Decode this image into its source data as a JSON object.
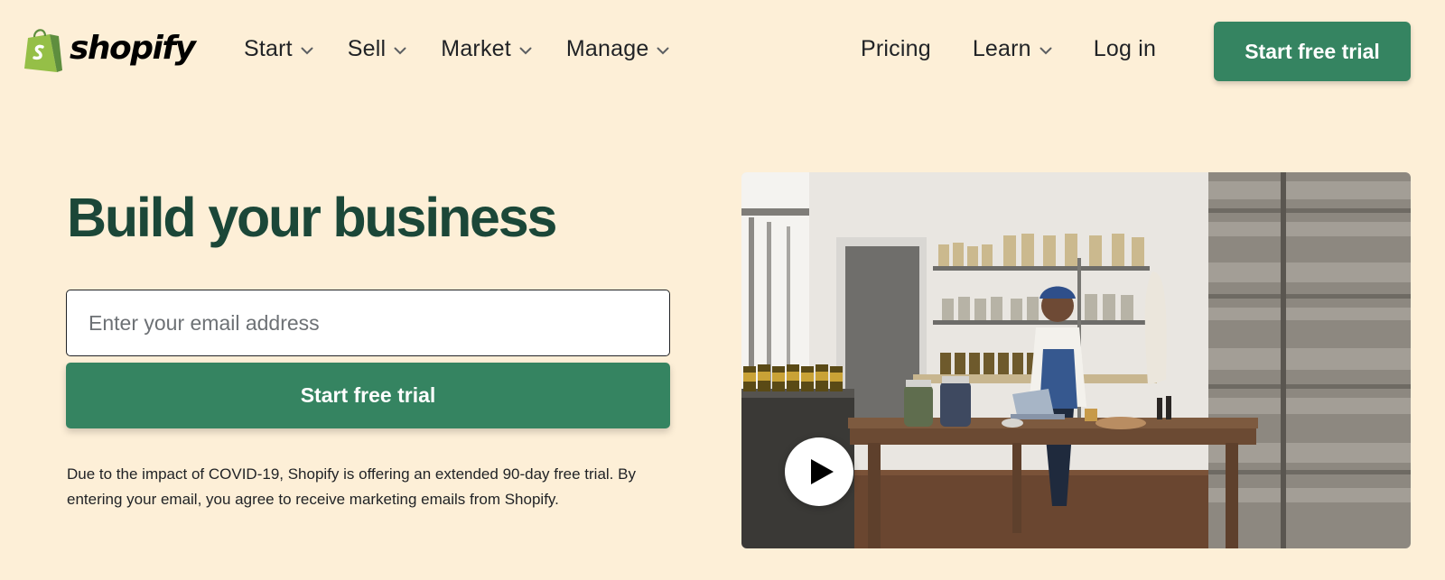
{
  "brand": {
    "logo_icon": "shopping-bag-logo",
    "wordmark": "shopify",
    "logo_green": "#95bf47",
    "logo_dark_green": "#5e8e3e"
  },
  "nav": {
    "left_items": [
      {
        "label": "Start",
        "icon": "chevron-down-icon"
      },
      {
        "label": "Sell",
        "icon": "chevron-down-icon"
      },
      {
        "label": "Market",
        "icon": "chevron-down-icon"
      },
      {
        "label": "Manage",
        "icon": "chevron-down-icon"
      }
    ],
    "pricing": "Pricing",
    "learn": {
      "label": "Learn",
      "icon": "chevron-down-icon"
    },
    "login": "Log in",
    "cta": "Start free trial"
  },
  "hero": {
    "headline": "Build your business",
    "email_placeholder": "Enter your email address",
    "email_value": "",
    "cta": "Start free trial",
    "disclaimer": "Due to the impact of COVID-19, Shopify is offering an extended 90-day free trial. By entering your email, you agree to receive marketing emails from Shopify.",
    "media": {
      "type": "video-thumbnail",
      "play_icon": "play-icon"
    }
  },
  "colors": {
    "page_background": "#fdefd7",
    "primary_button": "#358461",
    "headline": "#1b4738",
    "text": "#212326"
  }
}
